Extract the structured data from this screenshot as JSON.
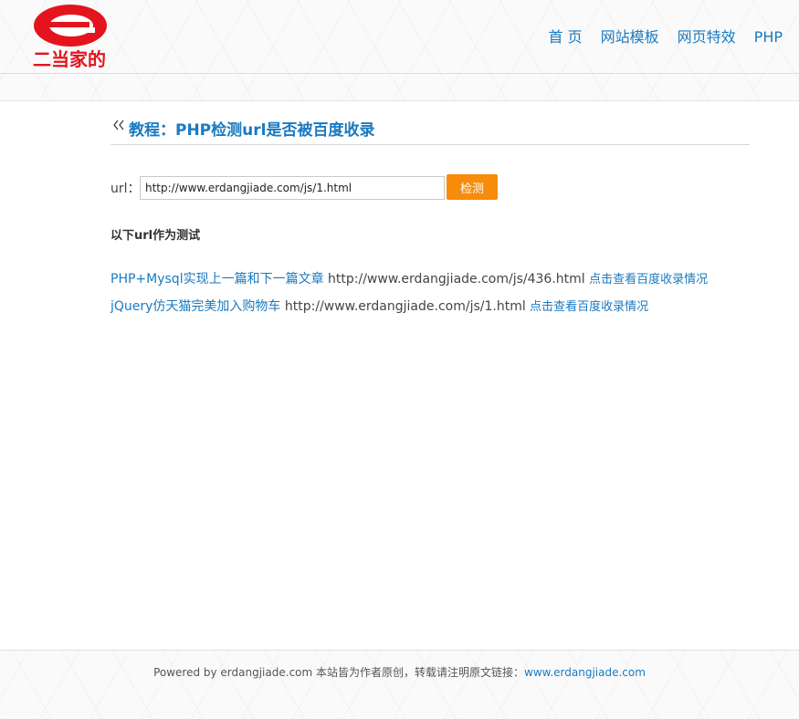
{
  "brand": {
    "logo_text": "二当家的",
    "logo_color": "#e3141e"
  },
  "nav": {
    "items": [
      "首 页",
      "网站模板",
      "网页特效",
      "PHP"
    ]
  },
  "page": {
    "title": "教程：PHP检测url是否被百度收录"
  },
  "form": {
    "url_label": "url：",
    "url_value": "http://www.erdangjiade.com/js/1.html",
    "submit_label": "检测"
  },
  "tests": {
    "heading": "以下url作为测试",
    "items": [
      {
        "title": "PHP+Mysql实现上一篇和下一篇文章",
        "url": "http://www.erdangjiade.com/js/436.html",
        "link": "点击查看百度收录情况"
      },
      {
        "title": "jQuery仿天猫完美加入购物车",
        "url": "http://www.erdangjiade.com/js/1.html",
        "link": "点击查看百度收录情况"
      }
    ]
  },
  "footer": {
    "text": "Powered by erdangjiade.com 本站皆为作者原创，转载请注明原文链接：",
    "link": "www.erdangjiade.com"
  },
  "colors": {
    "accent": "#1a7ac0",
    "button": "#f98b0a",
    "text": "#333333"
  }
}
